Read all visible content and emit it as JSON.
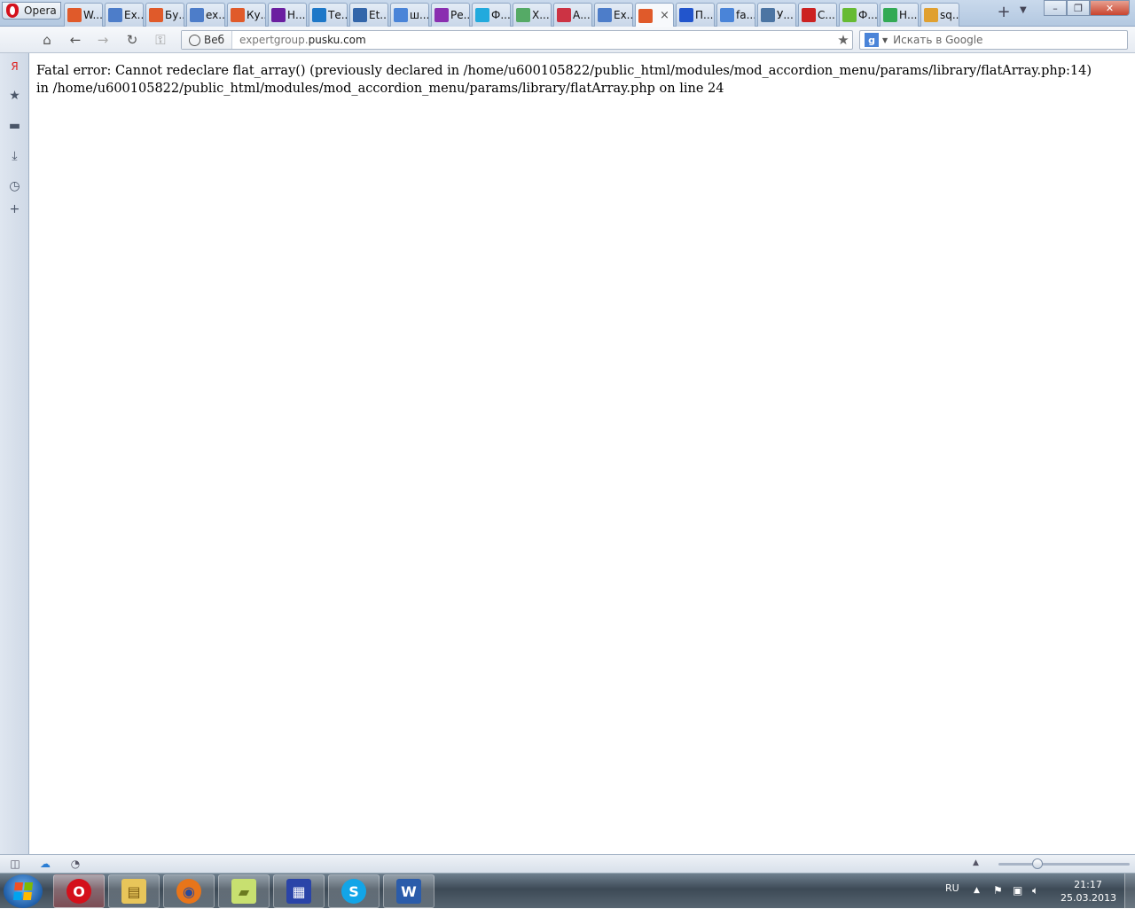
{
  "window": {
    "app_button_label": "Opera",
    "minimize_label": "–",
    "restore_label": "❐",
    "close_label": "✕"
  },
  "tabs": [
    {
      "label": "W...",
      "icon": "joomla-icon",
      "color": "#e05a2a"
    },
    {
      "label": "Ex...",
      "icon": "xml-icon",
      "color": "#4d7dc9"
    },
    {
      "label": "Бу...",
      "icon": "joomla-icon",
      "color": "#e05a2a"
    },
    {
      "label": "ex...",
      "icon": "xml-icon",
      "color": "#4d7dc9"
    },
    {
      "label": "Ку...",
      "icon": "joomla-icon",
      "color": "#e05a2a"
    },
    {
      "label": "Н...",
      "icon": "yahoo-icon",
      "color": "#6b1fa0"
    },
    {
      "label": "Те...",
      "icon": "upload-icon",
      "color": "#1e78c8"
    },
    {
      "label": "Et...",
      "icon": "list-icon",
      "color": "#3366aa"
    },
    {
      "label": "ш...",
      "icon": "google-icon",
      "color": "#4a84d8"
    },
    {
      "label": "Ре...",
      "icon": "ua-icon",
      "color": "#8a2fb0"
    },
    {
      "label": "Ф...",
      "icon": "pen-icon",
      "color": "#22aadd"
    },
    {
      "label": "Х...",
      "icon": "gear-icon",
      "color": "#55aa66"
    },
    {
      "label": "А...",
      "icon": "globe-icon",
      "color": "#cc3344"
    },
    {
      "label": "Ex...",
      "icon": "xml-icon",
      "color": "#4d7dc9"
    },
    {
      "label": "",
      "icon": "joomla-icon",
      "color": "#e05a2a",
      "active": true
    },
    {
      "label": "П...",
      "icon": "flag-ru-icon",
      "color": "#2255cc"
    },
    {
      "label": "fa...",
      "icon": "google-icon",
      "color": "#4a84d8"
    },
    {
      "label": "У...",
      "icon": "vk-icon",
      "color": "#4c75a3"
    },
    {
      "label": "С...",
      "icon": "gem-icon",
      "color": "#cc2222"
    },
    {
      "label": "Ф...",
      "icon": "f-icon",
      "color": "#66bb33"
    },
    {
      "label": "Н...",
      "icon": "check-icon",
      "color": "#33aa55"
    },
    {
      "label": "sq...",
      "icon": "pma-icon",
      "color": "#e0a030"
    }
  ],
  "nav": {
    "address_badge": "Веб",
    "url_host_prefix": "expertgroup.",
    "url_host_domain": "pusku.com",
    "search_engine_letter": "g",
    "search_placeholder": "Искать в Google"
  },
  "sidebar": {
    "items": [
      {
        "name": "yandex-icon",
        "glyph": "Я"
      },
      {
        "name": "bookmarks-icon",
        "glyph": "★"
      },
      {
        "name": "notes-icon",
        "glyph": "▬"
      },
      {
        "name": "downloads-icon",
        "glyph": "⤓"
      },
      {
        "name": "history-icon",
        "glyph": "◷"
      },
      {
        "name": "add-panel-icon",
        "glyph": "+"
      }
    ]
  },
  "page": {
    "error_text": "Fatal error: Cannot redeclare flat_array() (previously declared in /home/u600105822/public_html/modules/mod_accordion_menu/params/library/flatArray.php:14) in /home/u600105822/public_html/modules/mod_accordion_menu/params/library/flatArray.php on line 24"
  },
  "statusbar": {
    "zoom_level": 0.3
  },
  "taskbar": {
    "apps": [
      "opera",
      "explorer",
      "firefox",
      "sticky-notes",
      "save",
      "skype",
      "word"
    ],
    "language": "RU",
    "time": "21:17",
    "date": "25.03.2013"
  },
  "colors": {
    "opera_red": "#d4101b",
    "win_close": "#c8442e",
    "taskbar": "#3d4a56"
  }
}
